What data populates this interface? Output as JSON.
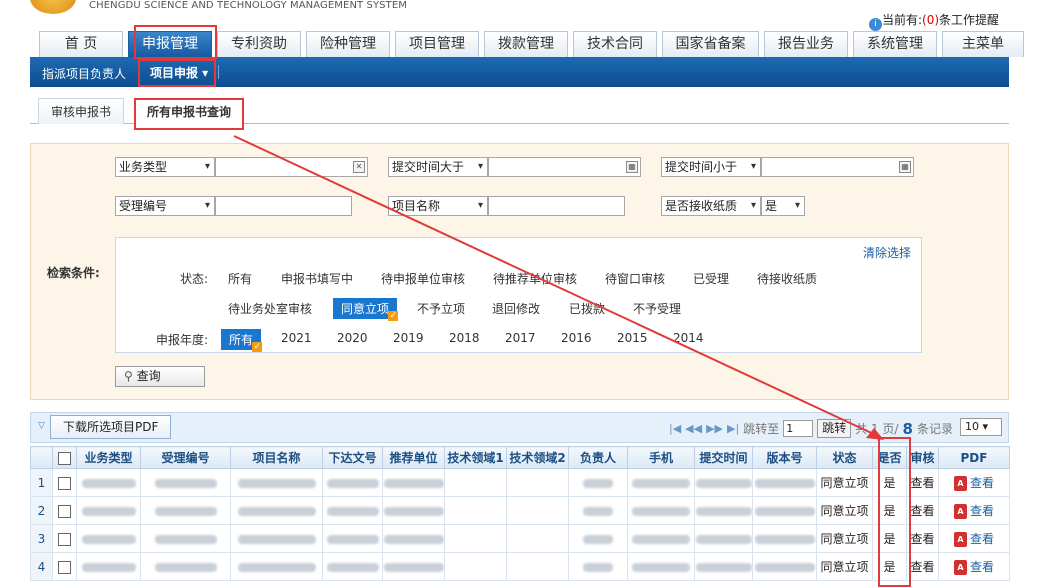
{
  "header": {
    "logo_text": "CHENGDU SCIENCE AND TECHNOLOGY MANAGEMENT SYSTEM",
    "notice_prefix": "当前有:",
    "notice_count": "(0)",
    "notice_suffix": "条工作提醒"
  },
  "main_nav": [
    "首 页",
    "申报管理",
    "专利资助",
    "险种管理",
    "项目管理",
    "拨款管理",
    "技术合同",
    "国家省备案",
    "报告业务",
    "系统管理",
    "主菜单"
  ],
  "sub_nav": {
    "item1": "指派项目负责人",
    "item2": "项目申报 ▾"
  },
  "page_tabs": [
    "审核申报书",
    "所有申报书查询"
  ],
  "filters": {
    "biz_type": "业务类型",
    "submit_gt": "提交时间大于",
    "submit_lt": "提交时间小于",
    "accept_no": "受理编号",
    "project_name": "项目名称",
    "paper_received": "是否接收纸质",
    "paper_value": "是",
    "search_label": "检索条件:",
    "clear": "清除选择",
    "status_label": "状态:",
    "status_row1": [
      "所有",
      "申报书填写中",
      "待申报单位审核",
      "待推荐单位审核",
      "待窗口审核",
      "已受理",
      "待接收纸质"
    ],
    "status_row2": [
      "待业务处室审核",
      "同意立项",
      "不予立项",
      "退回修改",
      "已拨款",
      "不予受理"
    ],
    "year_label": "申报年度:",
    "years": [
      "所有",
      "2021",
      "2020",
      "2019",
      "2018",
      "2017",
      "2016",
      "2015",
      "2014"
    ],
    "query_btn": "查询"
  },
  "grid_bar": {
    "download": "下载所选项目PDF",
    "jump_label": "跳转至",
    "jump_value": "1",
    "jump_btn": "跳转",
    "total_prefix": "共 1 页/",
    "total_count": "8",
    "total_suffix": "条记录",
    "page_size": "10"
  },
  "table": {
    "headers": [
      "业务类型",
      "受理编号",
      "项目名称",
      "下达文号",
      "推荐单位",
      "技术领域1",
      "技术领域2",
      "负责人",
      "手机",
      "提交时间",
      "版本号",
      "状态",
      "是否",
      "审核",
      "PDF"
    ],
    "rows": [
      {
        "n": "1",
        "status": "同意立项",
        "yes": "是",
        "view": "查看",
        "pdf_view": "查看"
      },
      {
        "n": "2",
        "status": "同意立项",
        "yes": "是",
        "view": "查看",
        "pdf_view": "查看"
      },
      {
        "n": "3",
        "status": "同意立项",
        "yes": "是",
        "view": "查看",
        "pdf_view": "查看"
      },
      {
        "n": "4",
        "status": "同意立项",
        "yes": "是",
        "view": "查看",
        "pdf_view": "查看"
      }
    ]
  },
  "colors": {
    "nav_active": "#1559a2",
    "subbar": "#0d4d8e",
    "annotation": "#e03a3a"
  },
  "icons": [
    "info-icon",
    "calendar-icon",
    "search-icon",
    "pager-first-icon",
    "pager-prev-icon",
    "pager-next-icon",
    "pager-last-icon",
    "pdf-icon",
    "collapse-icon"
  ]
}
